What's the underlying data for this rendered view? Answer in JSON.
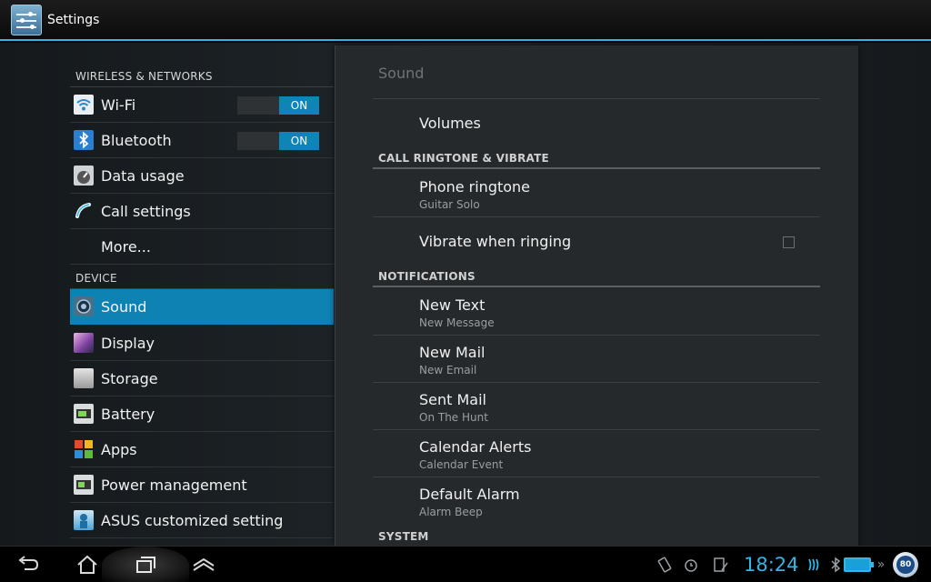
{
  "action_bar": {
    "title": "Settings"
  },
  "left_menu": {
    "sections": {
      "wireless": "WIRELESS & NETWORKS",
      "device": "DEVICE"
    },
    "items": [
      {
        "label": "Wi-Fi",
        "toggle": "ON",
        "icon": "wifi-icon"
      },
      {
        "label": "Bluetooth",
        "toggle": "ON",
        "icon": "bluetooth-icon"
      },
      {
        "label": "Data usage",
        "icon": "data-usage-icon"
      },
      {
        "label": "Call settings",
        "icon": "phone-icon"
      },
      {
        "label": "More..."
      },
      {
        "label": "Sound",
        "icon": "sound-icon",
        "selected": true
      },
      {
        "label": "Display",
        "icon": "display-icon"
      },
      {
        "label": "Storage",
        "icon": "storage-icon"
      },
      {
        "label": "Battery",
        "icon": "battery-icon"
      },
      {
        "label": "Apps",
        "icon": "apps-icon"
      },
      {
        "label": "Power management",
        "icon": "power-management-icon"
      },
      {
        "label": "ASUS customized setting",
        "icon": "asus-setting-icon"
      }
    ]
  },
  "sound_panel": {
    "title": "Sound",
    "volumes": "Volumes",
    "categories": {
      "ringtone": "CALL RINGTONE & VIBRATE",
      "notifications": "NOTIFICATIONS",
      "system": "SYSTEM"
    },
    "phone_ringtone": {
      "title": "Phone ringtone",
      "value": "Guitar Solo"
    },
    "vibrate": {
      "title": "Vibrate when ringing",
      "checked": false
    },
    "notifications": [
      {
        "title": "New Text",
        "value": "New Message"
      },
      {
        "title": "New Mail",
        "value": "New Email"
      },
      {
        "title": "Sent Mail",
        "value": "On The Hunt"
      },
      {
        "title": "Calendar Alerts",
        "value": "Calendar Event"
      },
      {
        "title": "Default Alarm",
        "value": "Alarm Beep"
      }
    ]
  },
  "system_bar": {
    "time": "18:24",
    "battery_badge": "80",
    "accent_color": "#33b5e5"
  }
}
